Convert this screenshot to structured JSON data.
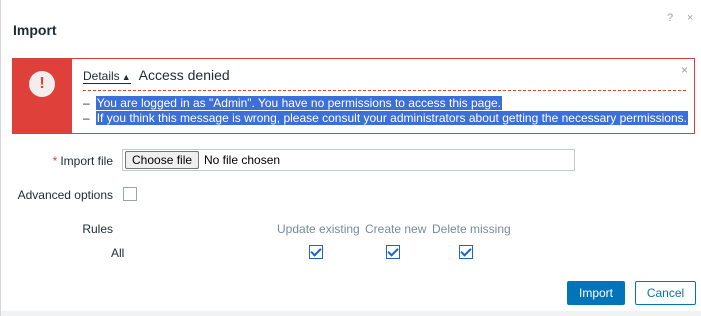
{
  "dialog": {
    "title": "Import",
    "help_glyph": "?",
    "close_glyph": "×"
  },
  "alert": {
    "icon_glyph": "!",
    "details_link": "Details",
    "details_caret": "▲",
    "heading": "Access denied",
    "close_glyph": "×",
    "bullet": "–",
    "messages": [
      "You are logged in as \"Admin\". You have no permissions to access this page.",
      "If you think this message is wrong, please consult your administrators about getting the necessary permissions."
    ]
  },
  "form": {
    "required_mark": "*",
    "import_file_label": "Import file",
    "choose_file_button": "Choose file",
    "no_file_text": "No file chosen",
    "advanced_options_label": "Advanced options",
    "advanced_options_checked": false,
    "rules_label": "Rules",
    "rules_columns": [
      "Update existing",
      "Create new",
      "Delete missing"
    ],
    "rules_rows": [
      {
        "label": "All",
        "update_existing": true,
        "create_new": true,
        "delete_missing": true
      }
    ]
  },
  "buttons": {
    "import": "Import",
    "cancel": "Cancel"
  },
  "colors": {
    "alert_red": "#e0403a",
    "primary_blue": "#0275b8",
    "selection_blue": "#3d6fd9"
  }
}
